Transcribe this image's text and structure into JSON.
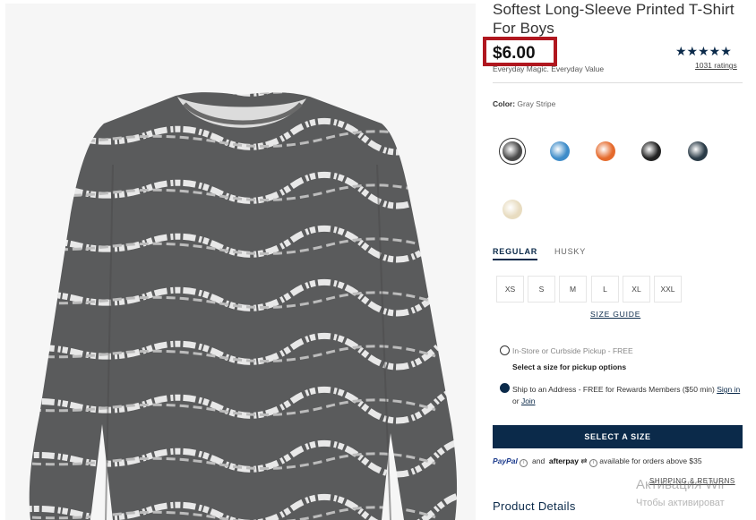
{
  "product": {
    "title": "Softest Long-Sleeve Printed T-Shirt For Boys",
    "price": "$6.00",
    "tagline": "Everyday Magic. Everyday Value",
    "stars": "★★★★★",
    "ratings_link": "1031 ratings"
  },
  "color": {
    "label": "Color:",
    "selected": "Gray Stripe",
    "swatches": [
      {
        "name": "gray-stripe",
        "color": "#4a4a4a",
        "selected": true
      },
      {
        "name": "blue-tie-dye",
        "color": "#3e8cc9",
        "selected": false
      },
      {
        "name": "orange-tie-dye",
        "color": "#e56a2c",
        "selected": false
      },
      {
        "name": "black",
        "color": "#222222",
        "selected": false
      },
      {
        "name": "dark-teal-tie-dye",
        "color": "#2a3b47",
        "selected": false
      },
      {
        "name": "cream",
        "color": "#e8dcc0",
        "selected": false
      }
    ]
  },
  "fit": {
    "tabs": [
      "REGULAR",
      "HUSKY"
    ],
    "active": "REGULAR"
  },
  "sizes": [
    "XS",
    "S",
    "M",
    "L",
    "XL",
    "XXL"
  ],
  "size_guide": "SIZE GUIDE",
  "fulfillment": {
    "pickup_label": "In-Store or Curbside Pickup - FREE",
    "pickup_hint": "Select a size for pickup options",
    "ship_label": "Ship to an Address - FREE for Rewards Members ($50 min)",
    "sign_in": "Sign in",
    "or_text": "or",
    "join": "Join"
  },
  "cta_label": "SELECT A SIZE",
  "payments": {
    "paypal": "PayPal",
    "and_text": "and",
    "afterpay": "afterpay",
    "note": "available for orders above $35"
  },
  "shipping_link": "SHIPPING & RETURNS",
  "details_heading": "Product Details",
  "os_watermark": {
    "line1": "Активация Wir",
    "line2": "Чтобы активироват"
  },
  "colors": {
    "navy": "#0b2a4a",
    "price_highlight": "#b0171f"
  }
}
